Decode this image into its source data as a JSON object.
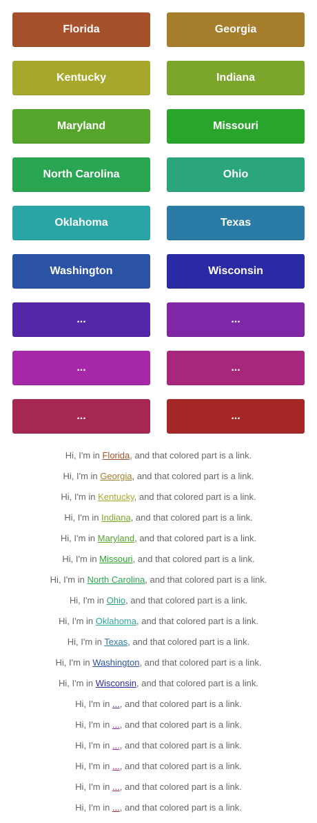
{
  "states": [
    {
      "label": "Florida",
      "color": "#a6512b"
    },
    {
      "label": "Georgia",
      "color": "#a57d2b"
    },
    {
      "label": "Kentucky",
      "color": "#a5a82b"
    },
    {
      "label": "Indiana",
      "color": "#7ba52b"
    },
    {
      "label": "Maryland",
      "color": "#55a52b"
    },
    {
      "label": "Missouri",
      "color": "#2aa52b"
    },
    {
      "label": "North Carolina",
      "color": "#2aa551"
    },
    {
      "label": "Ohio",
      "color": "#2aa57d"
    },
    {
      "label": "Oklahoma",
      "color": "#2aa5a5"
    },
    {
      "label": "Texas",
      "color": "#2a7ba5"
    },
    {
      "label": "Washington",
      "color": "#2a52a5"
    },
    {
      "label": "Wisconsin",
      "color": "#2a2aa5"
    },
    {
      "label": "...",
      "color": "#5327a7"
    },
    {
      "label": "...",
      "color": "#7f27a7"
    },
    {
      "label": "...",
      "color": "#a627a7"
    },
    {
      "label": "...",
      "color": "#a6277c"
    },
    {
      "label": "...",
      "color": "#a62752"
    },
    {
      "label": "...",
      "color": "#a62727"
    }
  ],
  "sentence": {
    "prefix": "Hi, I'm in ",
    "suffix": ", and that colored part is a link."
  }
}
